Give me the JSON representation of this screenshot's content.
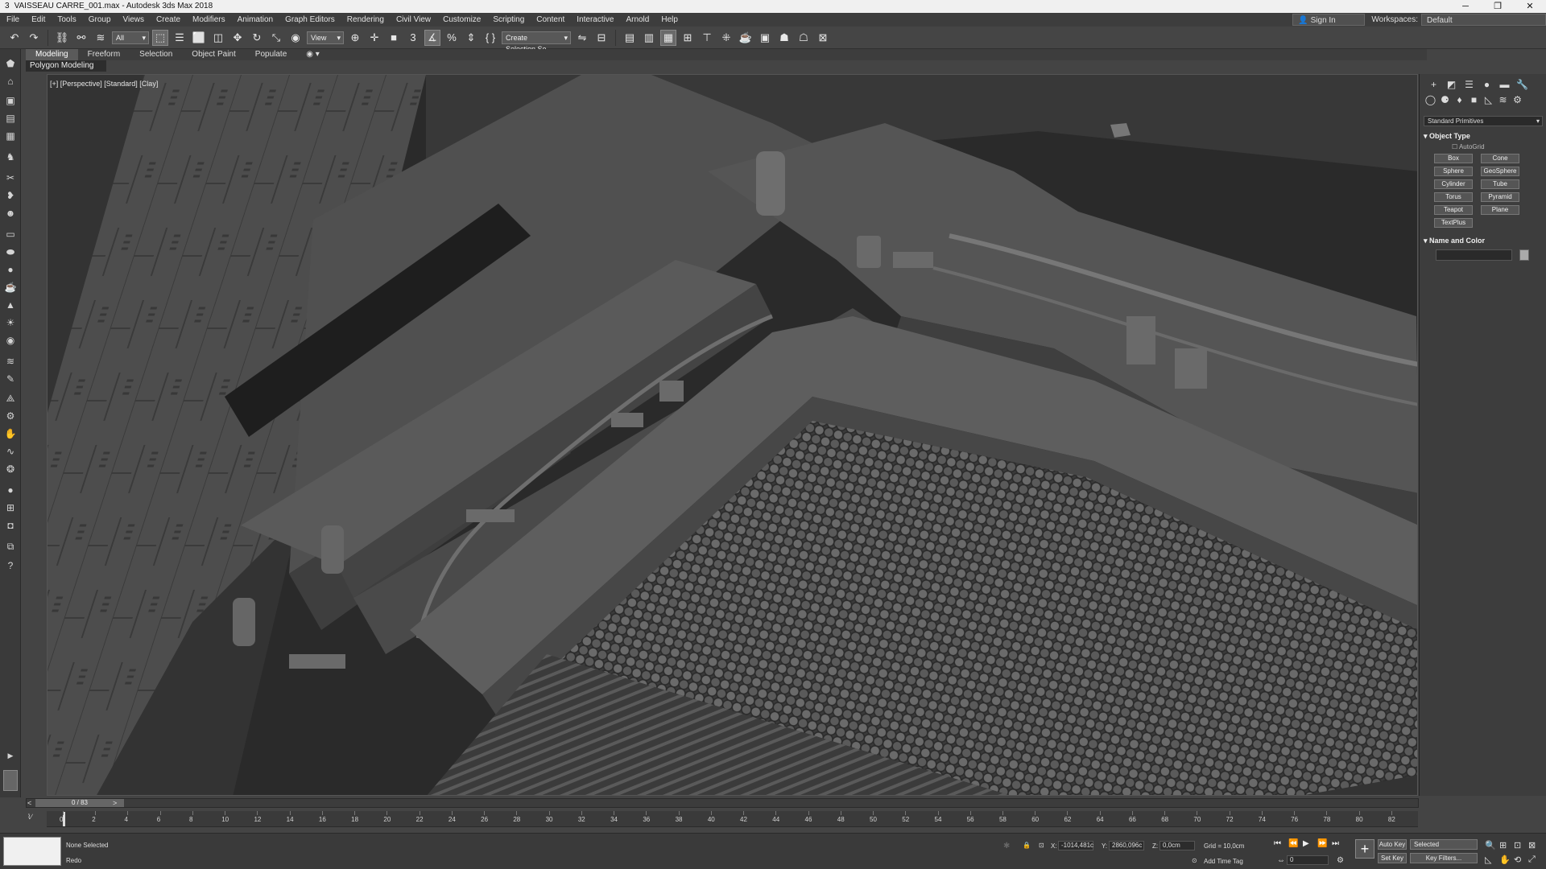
{
  "titlebar": {
    "icon": "3",
    "title": "VAISSEAU CARRE_001.max - Autodesk 3ds Max 2018"
  },
  "menu": [
    "File",
    "Edit",
    "Tools",
    "Group",
    "Views",
    "Create",
    "Modifiers",
    "Animation",
    "Graph Editors",
    "Rendering",
    "Civil View",
    "Customize",
    "Scripting",
    "Content",
    "Interactive",
    "Arnold",
    "Help"
  ],
  "account": {
    "signin": "Sign In",
    "workspaces_label": "Workspaces:",
    "workspace": "Default"
  },
  "toolbar": {
    "filter": "All",
    "refcoord": "View",
    "selection_set": "Create Selection Se"
  },
  "ribbon": {
    "tabs": [
      "Modeling",
      "Freeform",
      "Selection",
      "Object Paint",
      "Populate"
    ],
    "active": "Modeling",
    "subpanel": "Polygon Modeling"
  },
  "viewport": {
    "label": "[+] [Perspective] [Standard] [Clay]"
  },
  "command_panel": {
    "category": "Standard Primitives",
    "object_type_title": "Object Type",
    "autogrid": "AutoGrid",
    "buttons": [
      "Box",
      "Cone",
      "Sphere",
      "GeoSphere",
      "Cylinder",
      "Tube",
      "Torus",
      "Pyramid",
      "Teapot",
      "Plane",
      "TextPlus"
    ],
    "name_color_title": "Name and Color"
  },
  "time": {
    "slider": "0 / 83",
    "ticks": [
      "0",
      "2",
      "4",
      "6",
      "8",
      "10",
      "12",
      "14",
      "16",
      "18",
      "20",
      "22",
      "24",
      "26",
      "28",
      "30",
      "32",
      "34",
      "36",
      "38",
      "40",
      "42",
      "44",
      "46",
      "48",
      "50",
      "52",
      "54",
      "56",
      "58",
      "60",
      "62",
      "64",
      "66",
      "68",
      "70",
      "72",
      "74",
      "76",
      "78",
      "80",
      "82"
    ]
  },
  "status": {
    "selection": "None Selected",
    "prompt": "Redo",
    "x_label": "X:",
    "x": "-1014,481c",
    "y_label": "Y:",
    "y": "2860,096c",
    "z_label": "Z:",
    "z": "0,0cm",
    "grid": "Grid = 10,0cm",
    "add_time_tag": "Add Time Tag",
    "autokey": "Auto Key",
    "setkey": "Set Key",
    "key_mode": "Selected",
    "key_filters": "Key Filters...",
    "frame": "0"
  },
  "icons": [
    "undo-icon",
    "redo-icon",
    "link-icon",
    "unlink-icon",
    "bind-spacewarp-icon",
    "select-icon",
    "select-by-name-icon",
    "region-select-icon",
    "window-crossing-icon",
    "move-icon",
    "rotate-icon",
    "scale-icon",
    "placement-icon",
    "pivot-icon",
    "snaps-icon",
    "angle-snap-icon",
    "percent-snap-icon",
    "spinner-snap-icon",
    "edit-named-sel-icon",
    "mirror-icon",
    "align-icon",
    "layer-icon",
    "scene-explorer-icon",
    "ribbon-icon",
    "curve-editor-icon",
    "schematic-icon",
    "material-editor-icon",
    "render-setup-icon",
    "render-frame-icon",
    "render-icon",
    "render-iterative-icon",
    "render-cloud-icon"
  ],
  "colors": {
    "bg": "#444444",
    "panel": "#3d3d3d",
    "viewport_bg": "#262626",
    "titlebar": "#f0f0f0"
  }
}
